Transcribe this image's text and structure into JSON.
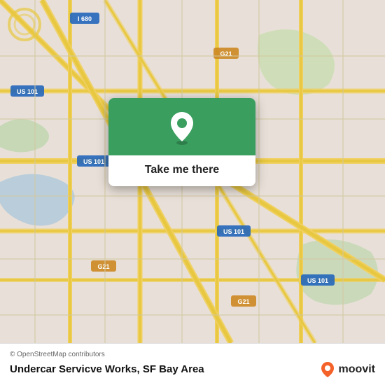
{
  "map": {
    "attribution": "© OpenStreetMap contributors",
    "background_color": "#e8e0d8"
  },
  "popup": {
    "button_label": "Take me there",
    "icon": "location-pin-icon"
  },
  "bottom_bar": {
    "attribution": "© OpenStreetMap contributors",
    "location_name": "Undercar Servicve Works, SF Bay Area",
    "brand": "moovit"
  }
}
